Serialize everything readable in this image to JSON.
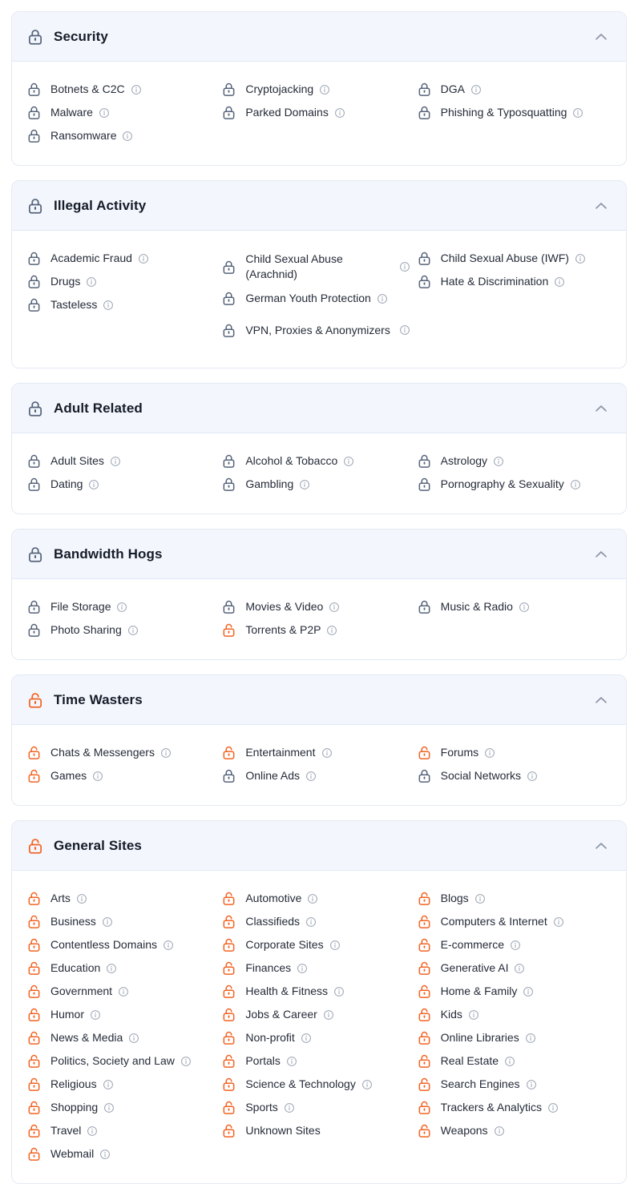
{
  "colors": {
    "locked": "#56637a",
    "unlocked": "#f26322",
    "header_bg": "#f3f7fd",
    "header_border": "#dfe9f7",
    "card_border": "#e4e9f2",
    "text": "#242b38",
    "info_icon": "#9aa3b2",
    "chevron": "#8d97a6"
  },
  "icons": {
    "locked": "padlock-closed-icon",
    "unlocked": "padlock-open-icon",
    "collapse": "chevron-up-icon",
    "info": "info-circle-icon"
  },
  "sections": [
    {
      "id": "security",
      "title": "Security",
      "state": "locked",
      "collapse_label": "Collapse",
      "columns": [
        [
          {
            "label": "Botnets & C2C",
            "state": "locked",
            "info": true
          },
          {
            "label": "Malware",
            "state": "locked",
            "info": true
          },
          {
            "label": "Ransomware",
            "state": "locked",
            "info": true
          }
        ],
        [
          {
            "label": "Cryptojacking",
            "state": "locked",
            "info": true
          },
          {
            "label": "Parked Domains",
            "state": "locked",
            "info": true
          }
        ],
        [
          {
            "label": "DGA",
            "state": "locked",
            "info": true
          },
          {
            "label": "Phishing & Typosquatting",
            "state": "locked",
            "info": true
          }
        ]
      ]
    },
    {
      "id": "illegal-activity",
      "title": "Illegal Activity",
      "state": "locked",
      "collapse_label": "Collapse",
      "columns": [
        [
          {
            "label": "Academic Fraud",
            "state": "locked",
            "info": true
          },
          {
            "label": "Drugs",
            "state": "locked",
            "info": true
          },
          {
            "label": "Tasteless",
            "state": "locked",
            "info": true
          }
        ],
        [
          {
            "label": "Child Sexual Abuse (Arachnid)",
            "state": "locked",
            "info": true,
            "wrap": true
          },
          {
            "label": "German Youth Protection",
            "state": "locked",
            "info": true
          },
          {
            "label": "VPN, Proxies & Anonymizers",
            "state": "locked",
            "info": true,
            "wrap": true
          }
        ],
        [
          {
            "label": "Child Sexual Abuse (IWF)",
            "state": "locked",
            "info": true
          },
          {
            "label": "Hate & Discrimination",
            "state": "locked",
            "info": true
          }
        ]
      ]
    },
    {
      "id": "adult-related",
      "title": "Adult Related",
      "state": "locked",
      "collapse_label": "Collapse",
      "columns": [
        [
          {
            "label": "Adult Sites",
            "state": "locked",
            "info": true
          },
          {
            "label": "Dating",
            "state": "locked",
            "info": true
          }
        ],
        [
          {
            "label": "Alcohol & Tobacco",
            "state": "locked",
            "info": true
          },
          {
            "label": "Gambling",
            "state": "locked",
            "info": true
          }
        ],
        [
          {
            "label": "Astrology",
            "state": "locked",
            "info": true
          },
          {
            "label": "Pornography & Sexuality",
            "state": "locked",
            "info": true
          }
        ]
      ]
    },
    {
      "id": "bandwidth-hogs",
      "title": "Bandwidth Hogs",
      "state": "locked",
      "collapse_label": "Collapse",
      "columns": [
        [
          {
            "label": "File Storage",
            "state": "locked",
            "info": true
          },
          {
            "label": "Photo Sharing",
            "state": "locked",
            "info": true
          }
        ],
        [
          {
            "label": "Movies & Video",
            "state": "locked",
            "info": true
          },
          {
            "label": "Torrents & P2P",
            "state": "unlocked",
            "info": true
          }
        ],
        [
          {
            "label": "Music & Radio",
            "state": "locked",
            "info": true
          }
        ]
      ]
    },
    {
      "id": "time-wasters",
      "title": "Time Wasters",
      "state": "unlocked",
      "collapse_label": "Collapse",
      "columns": [
        [
          {
            "label": "Chats & Messengers",
            "state": "unlocked",
            "info": true
          },
          {
            "label": "Games",
            "state": "unlocked",
            "info": true
          }
        ],
        [
          {
            "label": "Entertainment",
            "state": "unlocked",
            "info": true
          },
          {
            "label": "Online Ads",
            "state": "locked",
            "info": true
          }
        ],
        [
          {
            "label": "Forums",
            "state": "unlocked",
            "info": true
          },
          {
            "label": "Social Networks",
            "state": "locked",
            "info": true
          }
        ]
      ]
    },
    {
      "id": "general-sites",
      "title": "General Sites",
      "state": "unlocked",
      "collapse_label": "Collapse",
      "columns": [
        [
          {
            "label": "Arts",
            "state": "unlocked",
            "info": true
          },
          {
            "label": "Business",
            "state": "unlocked",
            "info": true
          },
          {
            "label": "Contentless Domains",
            "state": "unlocked",
            "info": true
          },
          {
            "label": "Education",
            "state": "unlocked",
            "info": true
          },
          {
            "label": "Government",
            "state": "unlocked",
            "info": true
          },
          {
            "label": "Humor",
            "state": "unlocked",
            "info": true
          },
          {
            "label": "News & Media",
            "state": "unlocked",
            "info": true
          },
          {
            "label": "Politics, Society and Law",
            "state": "unlocked",
            "info": true
          },
          {
            "label": "Religious",
            "state": "unlocked",
            "info": true
          },
          {
            "label": "Shopping",
            "state": "unlocked",
            "info": true
          },
          {
            "label": "Travel",
            "state": "unlocked",
            "info": true
          },
          {
            "label": "Webmail",
            "state": "unlocked",
            "info": true
          }
        ],
        [
          {
            "label": "Automotive",
            "state": "unlocked",
            "info": true
          },
          {
            "label": "Classifieds",
            "state": "unlocked",
            "info": true
          },
          {
            "label": "Corporate Sites",
            "state": "unlocked",
            "info": true
          },
          {
            "label": "Finances",
            "state": "unlocked",
            "info": true
          },
          {
            "label": "Health & Fitness",
            "state": "unlocked",
            "info": true
          },
          {
            "label": "Jobs & Career",
            "state": "unlocked",
            "info": true
          },
          {
            "label": "Non-profit",
            "state": "unlocked",
            "info": true
          },
          {
            "label": "Portals",
            "state": "unlocked",
            "info": true
          },
          {
            "label": "Science & Technology",
            "state": "unlocked",
            "info": true
          },
          {
            "label": "Sports",
            "state": "unlocked",
            "info": true
          },
          {
            "label": "Unknown Sites",
            "state": "unlocked",
            "info": false
          }
        ],
        [
          {
            "label": "Blogs",
            "state": "unlocked",
            "info": true
          },
          {
            "label": "Computers & Internet",
            "state": "unlocked",
            "info": true
          },
          {
            "label": "E-commerce",
            "state": "unlocked",
            "info": true
          },
          {
            "label": "Generative AI",
            "state": "unlocked",
            "info": true
          },
          {
            "label": "Home & Family",
            "state": "unlocked",
            "info": true
          },
          {
            "label": "Kids",
            "state": "unlocked",
            "info": true
          },
          {
            "label": "Online Libraries",
            "state": "unlocked",
            "info": true
          },
          {
            "label": "Real Estate",
            "state": "unlocked",
            "info": true
          },
          {
            "label": "Search Engines",
            "state": "unlocked",
            "info": true
          },
          {
            "label": "Trackers & Analytics",
            "state": "unlocked",
            "info": true
          },
          {
            "label": "Weapons",
            "state": "unlocked",
            "info": true
          }
        ]
      ]
    }
  ]
}
